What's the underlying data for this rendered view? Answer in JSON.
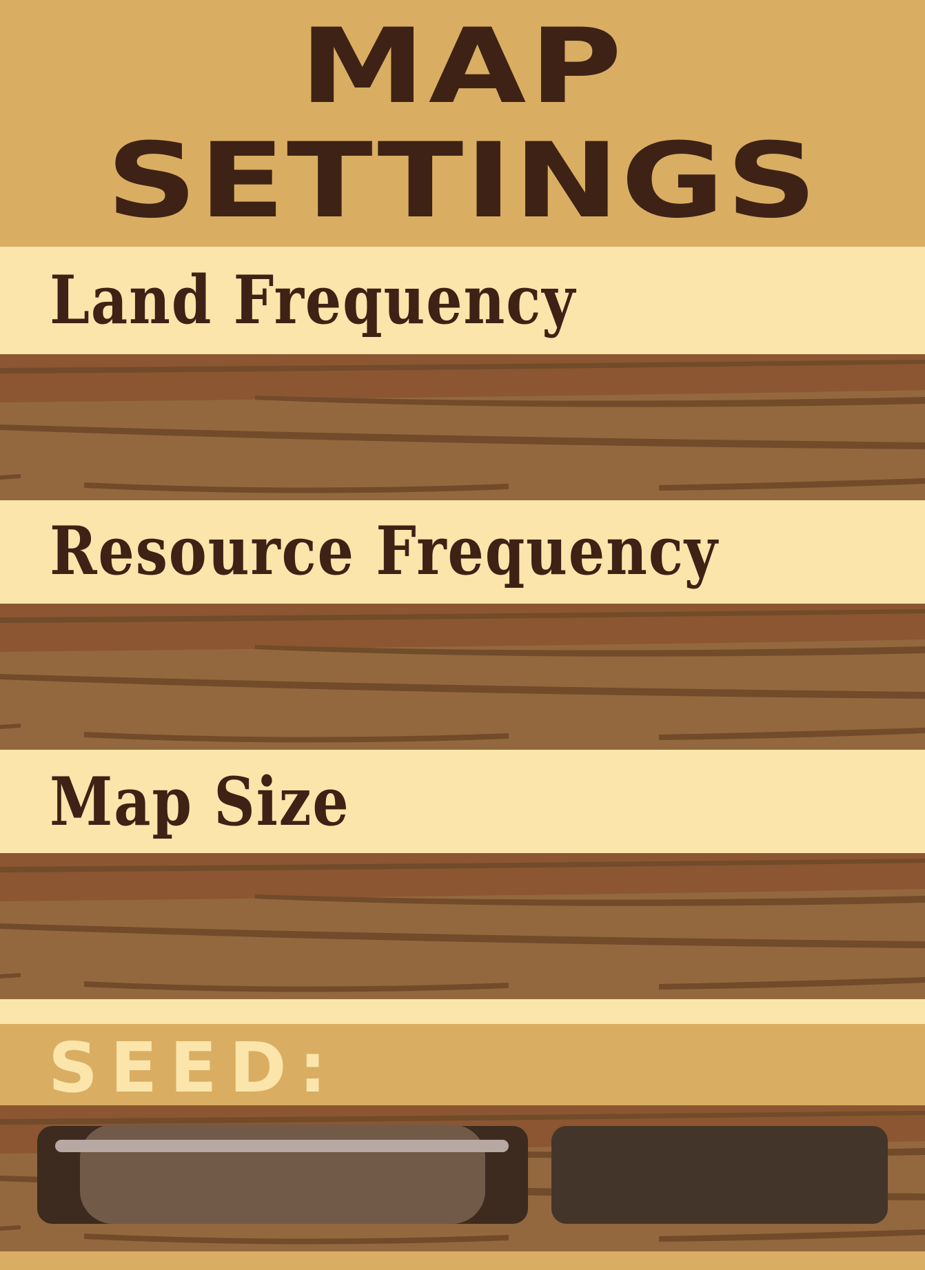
{
  "title": {
    "line1": "MAP",
    "line2": "SETTINGS"
  },
  "settings": [
    {
      "label": "Land Frequency"
    },
    {
      "label": "Resource Frequency"
    },
    {
      "label": "Map Size"
    }
  ],
  "seed": {
    "label": "SEED:"
  },
  "colors": {
    "header_bg": "#d9ae63",
    "label_band_bg": "#fbe5ab",
    "text_dark": "#3e2215",
    "wood_dark": "#8b5631",
    "wood_light": "#93683f",
    "wood_grain": "#714b2a",
    "control_dark": "#44352a",
    "slider_knob": "#725a49",
    "slider_track": "#b8a8a4"
  }
}
